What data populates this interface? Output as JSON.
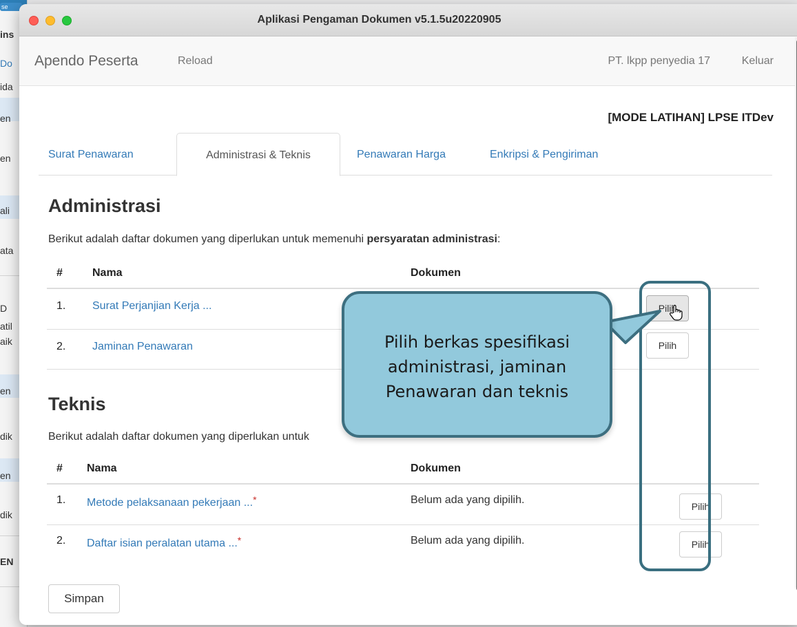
{
  "window": {
    "title": "Aplikasi Pengaman Dokumen v5.1.5u20220905"
  },
  "background_window": {
    "fragments": [
      "se",
      "ins",
      "Do",
      "ida",
      "en",
      "en",
      "ali",
      "ata",
      "D",
      "atil",
      "aik",
      "en",
      "dik",
      "en",
      "dik",
      "EN"
    ]
  },
  "navbar": {
    "brand": "Apendo Peserta",
    "reload": "Reload",
    "company": "PT. lkpp penyedia 17",
    "logout": "Keluar"
  },
  "mode_label": "[MODE LATIHAN] LPSE ITDev",
  "tabs": [
    {
      "label": "Surat Penawaran",
      "active": false
    },
    {
      "label": "Administrasi & Teknis",
      "active": true
    },
    {
      "label": "Penawaran Harga",
      "active": false
    },
    {
      "label": "Enkripsi & Pengiriman",
      "active": false
    }
  ],
  "administrasi": {
    "title": "Administrasi",
    "desc_prefix": "Berikut adalah daftar dokumen yang diperlukan untuk memenuhi ",
    "desc_bold": "persyaratan administrasi",
    "desc_suffix": ":",
    "headers": {
      "num": "#",
      "name": "Nama",
      "doc": "Dokumen"
    },
    "rows": [
      {
        "num": "1.",
        "name": "Surat Perjanjian Kerja ...",
        "button": "Pilih"
      },
      {
        "num": "2.",
        "name": "Jaminan Penawaran",
        "button": "Pilih"
      }
    ]
  },
  "teknis": {
    "title": "Teknis",
    "desc_visible": "Berikut adalah daftar dokumen yang diperlukan untuk",
    "headers": {
      "num": "#",
      "name": "Nama",
      "doc": "Dokumen"
    },
    "rows": [
      {
        "num": "1.",
        "name": "Metode pelaksanaan pekerjaan ...",
        "required": "*",
        "doc": "Belum ada yang dipilih.",
        "button": "Pilih"
      },
      {
        "num": "2.",
        "name": "Daftar isian peralatan utama ...",
        "required": "*",
        "doc": "Belum ada yang dipilih.",
        "button": "Pilih"
      }
    ]
  },
  "save_button": "Simpan",
  "callout": {
    "line1": "Pilih berkas spesifikasi",
    "line2": "administrasi, jaminan",
    "line3": "Penawaran dan teknis",
    "fill_color": "#92c9dc",
    "border_color": "#3d6f80"
  },
  "colors": {
    "link": "#337ab7",
    "required": "#c9302c"
  }
}
